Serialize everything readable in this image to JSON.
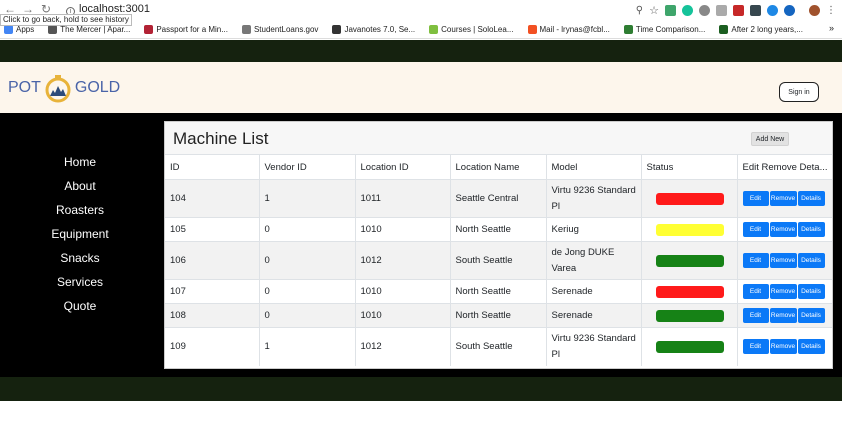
{
  "browser": {
    "url": "localhost:3001",
    "tooltip": "Click to go back, hold to see history",
    "bookmarks": [
      {
        "label": "Apps",
        "color": "#4285f4"
      },
      {
        "label": "The Mercer | Apar...",
        "color": "#555555"
      },
      {
        "label": "Passport for a Min...",
        "color": "#b22234"
      },
      {
        "label": "StudentLoans.gov",
        "color": "#777777"
      },
      {
        "label": "Javanotes 7.0, Se...",
        "color": "#333333"
      },
      {
        "label": "Courses | SoloLea...",
        "color": "#7fbf3f"
      },
      {
        "label": "Mail - lrynas@fcbl...",
        "color": "#f25022"
      },
      {
        "label": "Time Comparison...",
        "color": "#2e7d32"
      },
      {
        "label": "After 2 long years,...",
        "color": "#1b5e20"
      }
    ],
    "more": "»"
  },
  "header": {
    "logo_left": "POT",
    "logo_right": "GOLD",
    "sign_in": "Sign in"
  },
  "nav": [
    "Home",
    "About",
    "Roasters",
    "Equipment",
    "Snacks",
    "Services",
    "Quote"
  ],
  "panel": {
    "title": "Machine List",
    "add_new": "Add New"
  },
  "table": {
    "headers": [
      "ID",
      "Vendor ID",
      "Location ID",
      "Location Name",
      "Model",
      "Status",
      "Edit Remove Deta..."
    ],
    "button_labels": {
      "edit": "Edit",
      "remove": "Remove",
      "details": "Details"
    },
    "rows": [
      {
        "id": "104",
        "vendor_id": "1",
        "location_id": "1011",
        "location_name": "Seattle Central",
        "model": "Virtu 9236 Standard Pl",
        "status_color": "#ff1a1a"
      },
      {
        "id": "105",
        "vendor_id": "0",
        "location_id": "1010",
        "location_name": "North Seattle",
        "model": "Keriug",
        "status_color": "#ffff33"
      },
      {
        "id": "106",
        "vendor_id": "0",
        "location_id": "1012",
        "location_name": "South Seattle",
        "model": "de Jong DUKE Varea",
        "status_color": "#168216"
      },
      {
        "id": "107",
        "vendor_id": "0",
        "location_id": "1010",
        "location_name": "North Seattle",
        "model": "Serenade",
        "status_color": "#ff1a1a"
      },
      {
        "id": "108",
        "vendor_id": "0",
        "location_id": "1010",
        "location_name": "North Seattle",
        "model": "Serenade",
        "status_color": "#168216"
      },
      {
        "id": "109",
        "vendor_id": "1",
        "location_id": "1012",
        "location_name": "South Seattle",
        "model": "Virtu 9236 Standard Pl",
        "status_color": "#168216"
      }
    ]
  }
}
